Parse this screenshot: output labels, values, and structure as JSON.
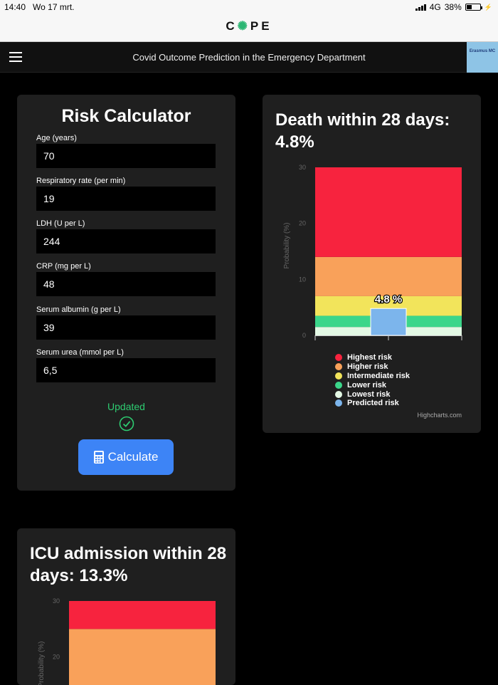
{
  "status_bar": {
    "time": "14:40",
    "date": "Wo 17 mrt.",
    "network": "4G",
    "battery": "38%",
    "battery_level": 0.38
  },
  "header": {
    "logo": "COPE",
    "logo_a": "C",
    "logo_b": "PE"
  },
  "navbar": {
    "title": "Covid Outcome Prediction in the Emergency Department",
    "logo_text": "Erasmus MC"
  },
  "risk_calculator": {
    "title": "Risk Calculator",
    "fields": [
      {
        "label": "Age (years)",
        "value": "70"
      },
      {
        "label": "Respiratory rate (per min)",
        "value": "19"
      },
      {
        "label": "LDH (U per L)",
        "value": "244"
      },
      {
        "label": "CRP (mg per L)",
        "value": "48"
      },
      {
        "label": "Serum albumin (g per L)",
        "value": "39"
      },
      {
        "label": "Serum urea (mmol per L)",
        "value": "6,5"
      }
    ],
    "status": "Updated",
    "button": "Calculate"
  },
  "death_card": {
    "title": "Death within 28 days: 4.8%",
    "credit": "Highcharts.com"
  },
  "icu_card": {
    "title": "ICU admission within 28 days: 13.3%"
  },
  "legend": [
    {
      "label": "Highest risk",
      "color": "#f7233e"
    },
    {
      "label": "Higher risk",
      "color": "#f9a15a"
    },
    {
      "label": "Intermediate risk",
      "color": "#f2e45b"
    },
    {
      "label": "Lower risk",
      "color": "#3bd68a"
    },
    {
      "label": "Lowest risk",
      "color": "#e3f8e4"
    },
    {
      "label": "Predicted risk",
      "color": "#7cb5ec"
    }
  ],
  "chart_data": [
    {
      "type": "bar",
      "ylabel": "Probability (%)",
      "ylim": [
        0,
        30
      ],
      "yticks": [
        0,
        10,
        20,
        30
      ],
      "bands": [
        {
          "name": "Lowest risk",
          "from": 0,
          "to": 1.5,
          "color": "#e3f8e4"
        },
        {
          "name": "Lower risk",
          "from": 1.5,
          "to": 3.5,
          "color": "#3bd68a"
        },
        {
          "name": "Intermediate risk",
          "from": 3.5,
          "to": 7,
          "color": "#f2e45b"
        },
        {
          "name": "Higher risk",
          "from": 7,
          "to": 14,
          "color": "#f9a15a"
        },
        {
          "name": "Highest risk",
          "from": 14,
          "to": 30,
          "color": "#f7233e"
        }
      ],
      "predicted": 4.8,
      "predicted_label": "4.8 %"
    },
    {
      "type": "bar",
      "ylabel": "Probability (%)",
      "ylim": [
        0,
        30
      ],
      "yticks": [
        20,
        30
      ],
      "bands": [
        {
          "name": "Higher risk",
          "from": 10,
          "to": 25,
          "color": "#f9a15a"
        },
        {
          "name": "Highest risk",
          "from": 25,
          "to": 30,
          "color": "#f7233e"
        }
      ]
    }
  ]
}
